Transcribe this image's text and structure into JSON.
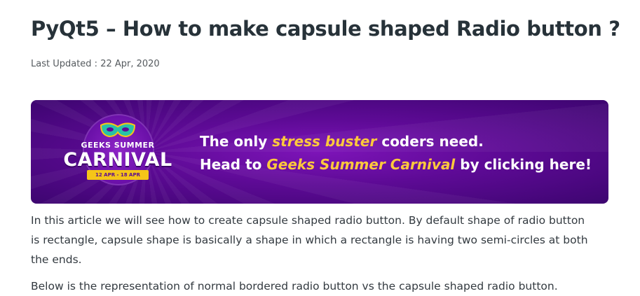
{
  "article": {
    "title": "PyQt5 – How to make capsule shaped Radio button ?",
    "last_updated": "Last Updated : 22 Apr, 2020"
  },
  "banner": {
    "logo": {
      "small_text": "GEEKS SUMMER",
      "big_text": "CARNIVAL",
      "dates": "12 APR - 18 APR"
    },
    "line1_before": "The only ",
    "line1_highlight": "stress buster",
    "line1_after": " coders need.",
    "line2_before": "Head to ",
    "line2_highlight": "Geeks Summer Carnival",
    "line2_after": " by clicking here!",
    "colors": {
      "background": "#5d0a95",
      "highlight": "#ffc93c",
      "ribbon": "#f5c518"
    }
  },
  "content": {
    "paragraph1": "In this article we will see how to create capsule shaped radio button. By default shape of radio button is rectangle, capsule shape is basically a shape in which a rectangle is having two semi-circles at both the ends.",
    "paragraph2": "Below is the representation of normal bordered radio button vs the capsule shaped radio button."
  }
}
